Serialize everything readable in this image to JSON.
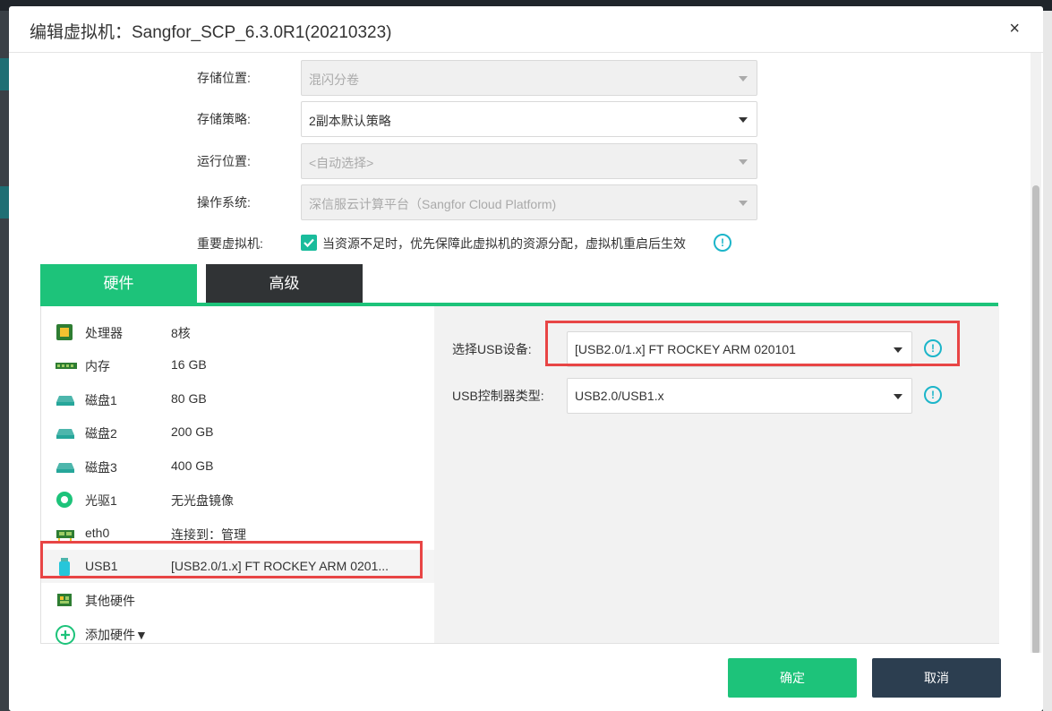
{
  "dialog": {
    "title": "编辑虚拟机：Sangfor_SCP_6.3.0R1(20210323)",
    "close": "×"
  },
  "form": {
    "storage_location": {
      "label": "存储位置:",
      "value": "混闪分卷"
    },
    "storage_policy": {
      "label": "存储策略:",
      "value": "2副本默认策略"
    },
    "run_location": {
      "label": "运行位置:",
      "value": "<自动选择>"
    },
    "os": {
      "label": "操作系统:",
      "value": "深信服云计算平台（Sangfor Cloud Platform)"
    },
    "important_vm": {
      "label": "重要虚拟机:",
      "checkbox_text": "当资源不足时，优先保障此虚拟机的资源分配，虚拟机重启后生效",
      "checked": true
    }
  },
  "tabs": {
    "hardware": "硬件",
    "advanced": "高级"
  },
  "hardware": [
    {
      "name": "处理器",
      "value": "8核",
      "icon": "cpu-icon"
    },
    {
      "name": "内存",
      "value": "16 GB",
      "icon": "memory-icon"
    },
    {
      "name": "磁盘1",
      "value": "80 GB",
      "icon": "disk-icon"
    },
    {
      "name": "磁盘2",
      "value": "200 GB",
      "icon": "disk-icon"
    },
    {
      "name": "磁盘3",
      "value": "400 GB",
      "icon": "disk-icon"
    },
    {
      "name": "光驱1",
      "value": "无光盘镜像",
      "icon": "cdrom-icon"
    },
    {
      "name": "eth0",
      "value": "连接到：管理",
      "icon": "nic-icon"
    },
    {
      "name": "USB1",
      "value": "[USB2.0/1.x] FT ROCKEY ARM 0201...",
      "icon": "usb-icon"
    },
    {
      "name": "其他硬件",
      "value": "",
      "icon": "other-hardware-icon"
    },
    {
      "name": "添加硬件▼",
      "value": "",
      "icon": "add-icon"
    }
  ],
  "usb_detail": {
    "device_label": "选择USB设备:",
    "device_value": "[USB2.0/1.x] FT ROCKEY ARM 020101",
    "controller_label": "USB控制器类型:",
    "controller_value": "USB2.0/USB1.x"
  },
  "footer": {
    "ok": "确定",
    "cancel": "取消"
  },
  "colors": {
    "accent": "#1dc37a",
    "cancel_bg": "#2c3e50",
    "highlight": "#e84545",
    "info": "#1cb5c9"
  }
}
